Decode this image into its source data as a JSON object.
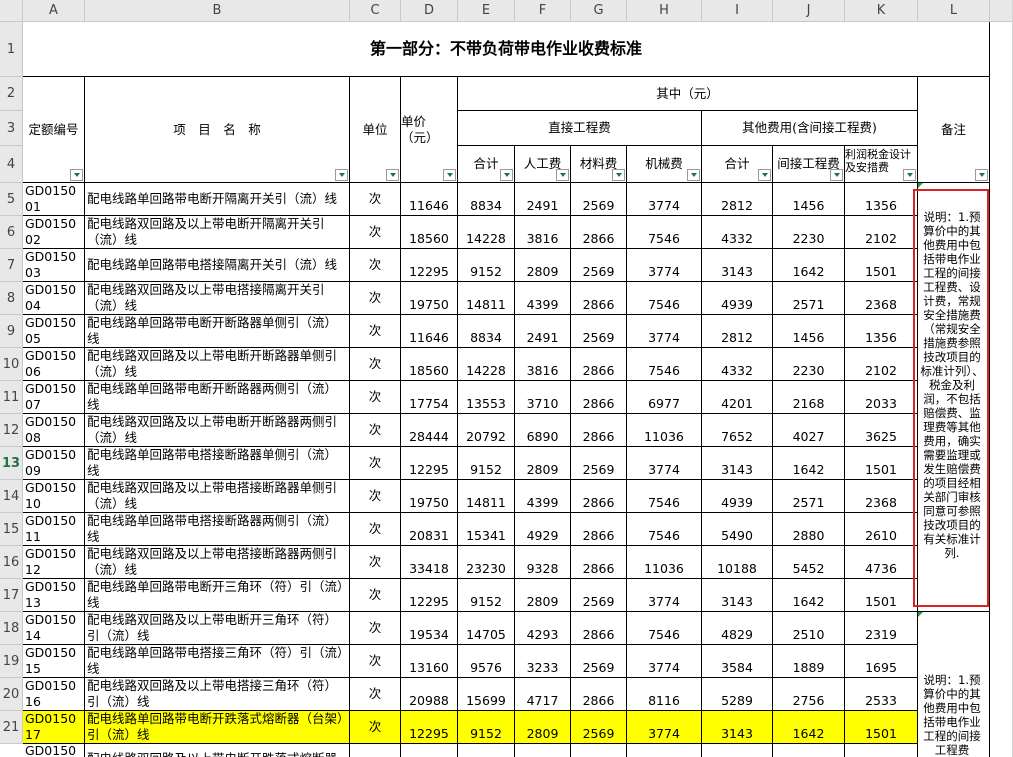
{
  "columns": [
    "A",
    "B",
    "C",
    "D",
    "E",
    "F",
    "G",
    "H",
    "I",
    "J",
    "K",
    "L"
  ],
  "row_numbers": [
    "1",
    "2",
    "3",
    "4",
    "5",
    "6",
    "7",
    "8",
    "9",
    "10",
    "11",
    "12",
    "13",
    "14",
    "15",
    "16",
    "17",
    "18",
    "19",
    "20",
    "21"
  ],
  "selected_row": "13",
  "title": "第一部分：不带负荷带电作业收费标准",
  "headers": {
    "code": "定额编号",
    "name": "项　目　名　称",
    "unit": "单位",
    "price": "单价（元）",
    "among": "其中（元）",
    "direct": "直接工程费",
    "other": "其他费用(含间接工程费)",
    "total": "合计",
    "labor": "人工费",
    "material": "材料费",
    "machine": "机械费",
    "other_total": "合计",
    "indirect": "间接工程费",
    "profit": "利润税金设计及安措费",
    "remark": "备注"
  },
  "rows": [
    {
      "code": "GD015001",
      "name": "配电线路单回路带电断开隔离开关引（流）线",
      "unit": "次",
      "price": "11646",
      "total": "8834",
      "labor": "2491",
      "material": "2569",
      "machine": "3774",
      "other_total": "2812",
      "indirect": "1456",
      "profit": "1356"
    },
    {
      "code": "GD015002",
      "name": "配电线路双回路及以上带电断开隔离开关引（流）线",
      "unit": "次",
      "price": "18560",
      "total": "14228",
      "labor": "3816",
      "material": "2866",
      "machine": "7546",
      "other_total": "4332",
      "indirect": "2230",
      "profit": "2102"
    },
    {
      "code": "GD015003",
      "name": "配电线路单回路带电搭接隔离开关引（流）线",
      "unit": "次",
      "price": "12295",
      "total": "9152",
      "labor": "2809",
      "material": "2569",
      "machine": "3774",
      "other_total": "3143",
      "indirect": "1642",
      "profit": "1501"
    },
    {
      "code": "GD015004",
      "name": "配电线路双回路及以上带电搭接隔离开关引（流）线",
      "unit": "次",
      "price": "19750",
      "total": "14811",
      "labor": "4399",
      "material": "2866",
      "machine": "7546",
      "other_total": "4939",
      "indirect": "2571",
      "profit": "2368"
    },
    {
      "code": "GD015005",
      "name": "配电线路单回路带电断开断路器单侧引（流）线",
      "unit": "次",
      "price": "11646",
      "total": "8834",
      "labor": "2491",
      "material": "2569",
      "machine": "3774",
      "other_total": "2812",
      "indirect": "1456",
      "profit": "1356"
    },
    {
      "code": "GD015006",
      "name": "配电线路双回路及以上带电断开断路器单侧引（流）线",
      "unit": "次",
      "price": "18560",
      "total": "14228",
      "labor": "3816",
      "material": "2866",
      "machine": "7546",
      "other_total": "4332",
      "indirect": "2230",
      "profit": "2102"
    },
    {
      "code": "GD015007",
      "name": "配电线路单回路带电断开断路器两侧引（流）线",
      "unit": "次",
      "price": "17754",
      "total": "13553",
      "labor": "3710",
      "material": "2866",
      "machine": "6977",
      "other_total": "4201",
      "indirect": "2168",
      "profit": "2033"
    },
    {
      "code": "GD015008",
      "name": "配电线路双回路及以上带电断开断路器两侧引（流）线",
      "unit": "次",
      "price": "28444",
      "total": "20792",
      "labor": "6890",
      "material": "2866",
      "machine": "11036",
      "other_total": "7652",
      "indirect": "4027",
      "profit": "3625"
    },
    {
      "code": "GD015009",
      "name": "配电线路单回路带电搭接断路器单侧引（流）线",
      "unit": "次",
      "price": "12295",
      "total": "9152",
      "labor": "2809",
      "material": "2569",
      "machine": "3774",
      "other_total": "3143",
      "indirect": "1642",
      "profit": "1501"
    },
    {
      "code": "GD015010",
      "name": "配电线路双回路及以上带电搭接断路器单侧引（流）线",
      "unit": "次",
      "price": "19750",
      "total": "14811",
      "labor": "4399",
      "material": "2866",
      "machine": "7546",
      "other_total": "4939",
      "indirect": "2571",
      "profit": "2368"
    },
    {
      "code": "GD015011",
      "name": "配电线路单回路带电搭接断路器两侧引（流）线",
      "unit": "次",
      "price": "20831",
      "total": "15341",
      "labor": "4929",
      "material": "2866",
      "machine": "7546",
      "other_total": "5490",
      "indirect": "2880",
      "profit": "2610"
    },
    {
      "code": "GD015012",
      "name": "配电线路双回路及以上带电搭接断路器两侧引（流）线",
      "unit": "次",
      "price": "33418",
      "total": "23230",
      "labor": "9328",
      "material": "2866",
      "machine": "11036",
      "other_total": "10188",
      "indirect": "5452",
      "profit": "4736"
    },
    {
      "code": "GD015013",
      "name": "配电线路单回路带电断开三角环（符）引（流）线",
      "unit": "次",
      "price": "12295",
      "total": "9152",
      "labor": "2809",
      "material": "2569",
      "machine": "3774",
      "other_total": "3143",
      "indirect": "1642",
      "profit": "1501"
    },
    {
      "code": "GD015014",
      "name": "配电线路双回路及以上带电断开三角环（符）引（流）线",
      "unit": "次",
      "price": "19534",
      "total": "14705",
      "labor": "4293",
      "material": "2866",
      "machine": "7546",
      "other_total": "4829",
      "indirect": "2510",
      "profit": "2319"
    },
    {
      "code": "GD015015",
      "name": "配电线路单回路带电搭接三角环（符）引（流）线",
      "unit": "次",
      "price": "13160",
      "total": "9576",
      "labor": "3233",
      "material": "2569",
      "machine": "3774",
      "other_total": "3584",
      "indirect": "1889",
      "profit": "1695"
    },
    {
      "code": "GD015016",
      "name": "配电线路双回路及以上带电搭接三角环（符）引（流）线",
      "unit": "次",
      "price": "20988",
      "total": "15699",
      "labor": "4717",
      "material": "2866",
      "machine": "8116",
      "other_total": "5289",
      "indirect": "2756",
      "profit": "2533"
    },
    {
      "code": "GD015017",
      "name": "配电线路单回路带电断开跌落式熔断器（台架）引（流）线",
      "unit": "次",
      "price": "12295",
      "total": "9152",
      "labor": "2809",
      "material": "2569",
      "machine": "3774",
      "other_total": "3143",
      "indirect": "1642",
      "profit": "1501",
      "highlight": true
    },
    {
      "code": "GD015018",
      "name": "配电线路双回路及以上带电断开跌落式熔断器",
      "unit": "",
      "price": "",
      "total": "",
      "labor": "",
      "material": "",
      "machine": "",
      "other_total": "",
      "indirect": "",
      "profit": ""
    }
  ],
  "remark_note_1": "说明：1.预算价中的其他费用中包括带电作业工程的间接工程费、设计费，常规安全措施费（常规安全措施费参照技改项目的标准计列）、税金及利润，不包括赔偿费、监理费等其他费用，确实需要监理或发生赔偿费的项目经相关部门审核同意可参照技改项目的有关标准计列.",
  "remark_note_2": "说明：1.预算价中的其他费用中包括带电作业工程的间接工程费",
  "colors": {
    "highlight": "#ffff00",
    "red_box": "#e02020",
    "header_bg": "#e8e8e8",
    "selected_row": "#217346"
  }
}
